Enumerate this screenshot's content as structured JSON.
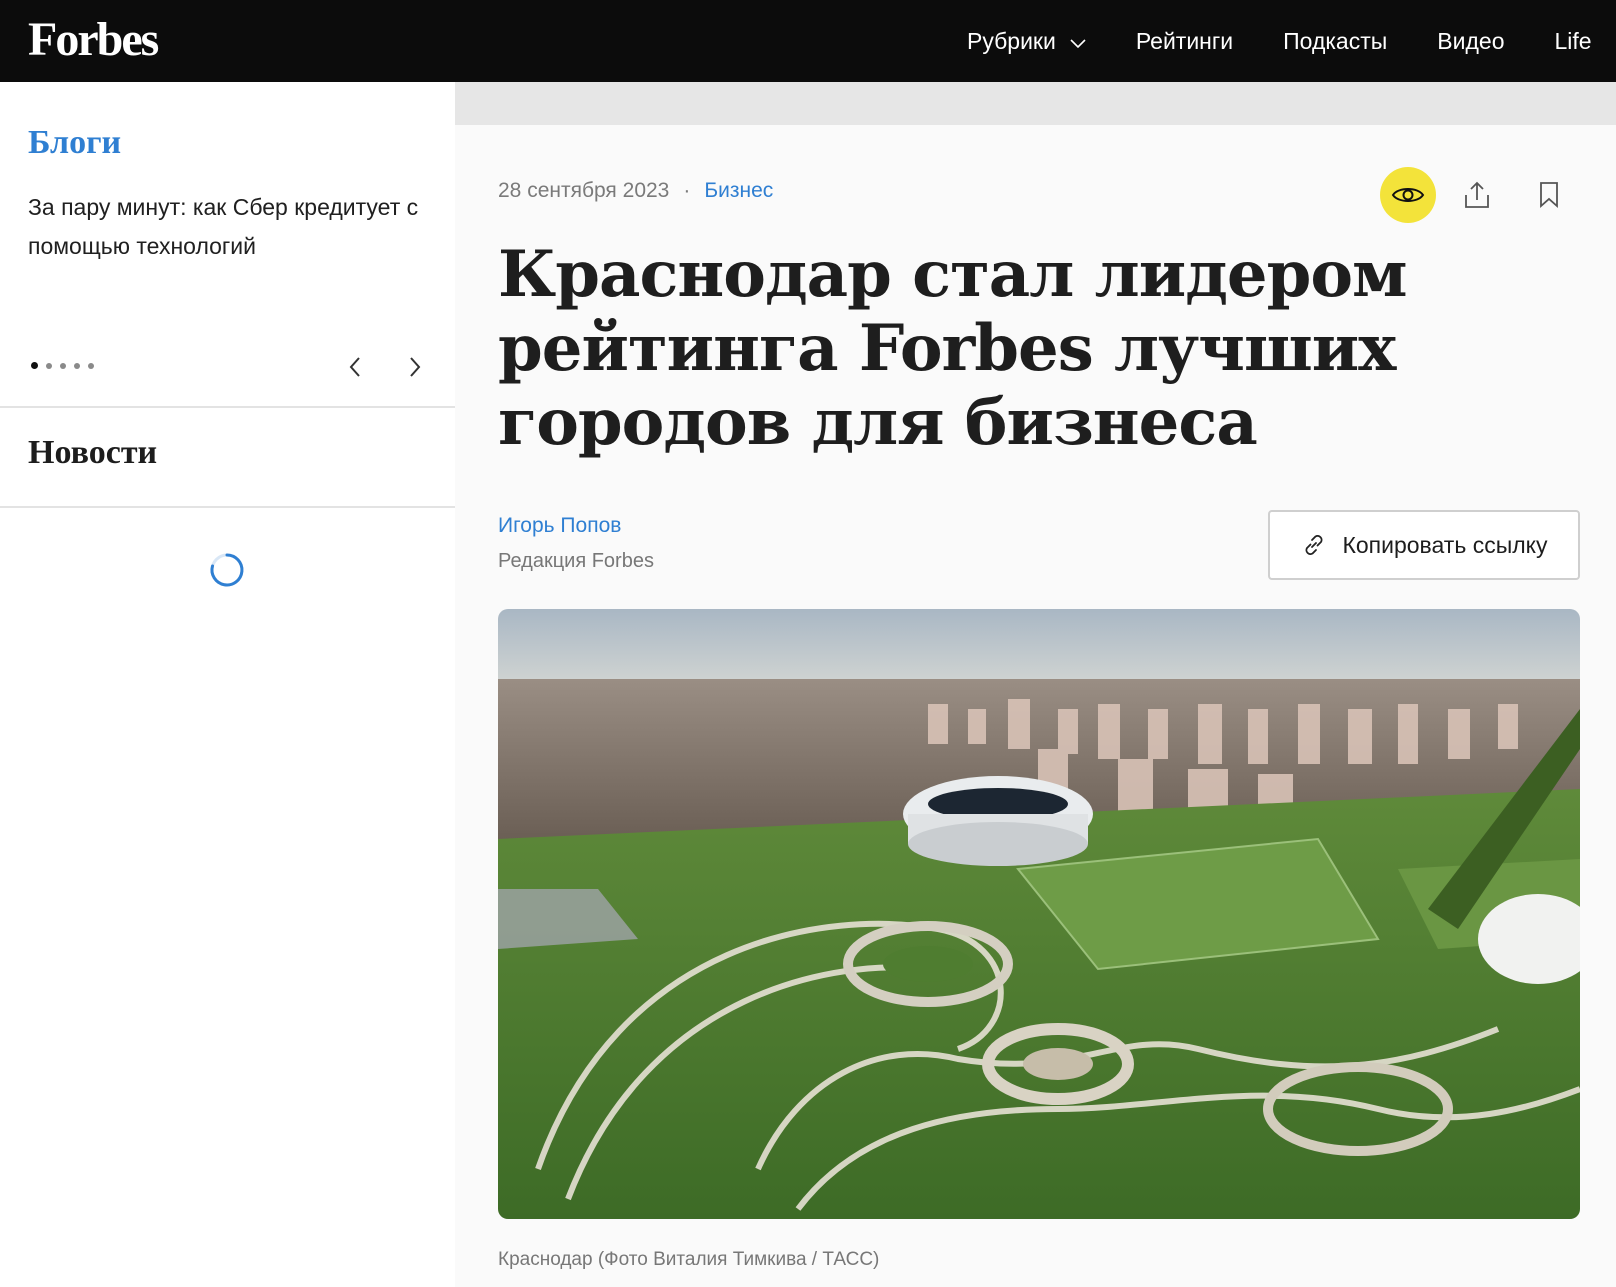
{
  "header": {
    "logo": "Forbes",
    "nav": [
      {
        "label": "Рубрики",
        "has_dropdown": true
      },
      {
        "label": "Рейтинги"
      },
      {
        "label": "Подкасты"
      },
      {
        "label": "Видео"
      },
      {
        "label": "Life"
      }
    ]
  },
  "sidebar": {
    "blogs_title": "Блоги",
    "blog_item": "За пару минут: как Сбер кредиту­ет с помощью технологий",
    "carousel_pages": 5,
    "carousel_active": 1,
    "news_title": "Новости"
  },
  "article": {
    "date": "28 сентября 2023",
    "separator": "·",
    "rubric": "Бизнес",
    "headline": "Краснодар стал лидером рей­тинга Forbes лучших городов для бизнеса",
    "author": "Игорь Попов",
    "author_role": "Редакция Forbes",
    "copy_link_label": "Копировать ссылку",
    "photo_caption": "Краснодар (Фото Виталия Тимкива / ТАСС)"
  },
  "colors": {
    "accent_blue": "#2f7fd2",
    "highlight_yellow": "#f3e33a",
    "header_bg": "#0c0c0c"
  },
  "icons": [
    "chevron-down-icon",
    "chevron-left-icon",
    "chevron-right-icon",
    "eye-icon",
    "share-icon",
    "bookmark-icon",
    "link-icon",
    "spinner-icon"
  ]
}
